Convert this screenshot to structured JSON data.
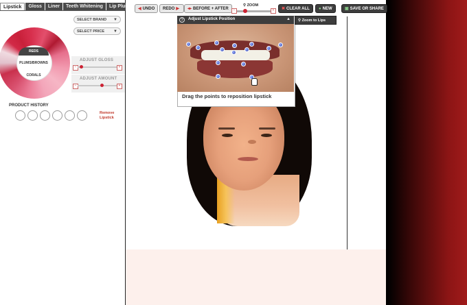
{
  "tabs": [
    "Lipstick",
    "Gloss",
    "Liner",
    "Teeth Whitening",
    "Lip Plump"
  ],
  "active_tab": "Lipstick",
  "filters": {
    "brand": "SELECT BRAND",
    "price": "SELECT PRICE"
  },
  "wheel": {
    "selected": "REDS",
    "segments": [
      "REDS",
      "PLUMS/BROWNS",
      "CORALS"
    ]
  },
  "sliders": {
    "gloss_label": "ADJUST GLOSS",
    "amount_label": "ADJUST AMOUNT",
    "gloss_level": 0.05,
    "amount_level": 0.6,
    "minus": "−",
    "plus": "+"
  },
  "history": {
    "title": "PRODUCT HISTORY",
    "remove_label_1": "Remove",
    "remove_label_2": "Lipstick"
  },
  "toolbar": {
    "undo": "UNDO",
    "redo": "REDO",
    "before_after": "BEFORE + AFTER",
    "zoom": "ZOOM",
    "zoom_level": 0.2,
    "clear_all": "CLEAR ALL",
    "new": "NEW",
    "save_share": "SAVE OR SHARE"
  },
  "lips_panel": {
    "title": "Adjust Lipstick Position",
    "help": "?",
    "caret": "▲",
    "instruction": "Drag the points to reposition lipstick",
    "zoom_button": "Zoom to Lips"
  },
  "colors": {
    "accent": "#c23030",
    "dark_button": "#3d3d3d",
    "wheel_red": "#c8203a"
  }
}
